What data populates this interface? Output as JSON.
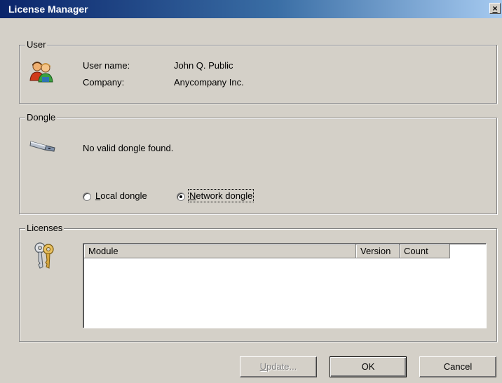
{
  "window": {
    "title": "License Manager",
    "close_glyph": "×"
  },
  "user": {
    "legend": "User",
    "icon": "users-icon",
    "name_label": "User name:",
    "name_value": "John Q. Public",
    "company_label": "Company:",
    "company_value": "Anycompany Inc."
  },
  "dongle": {
    "legend": "Dongle",
    "icon": "usb-dongle-icon",
    "status": "No valid dongle found.",
    "options": [
      {
        "accel": "L",
        "rest": "ocal dongle",
        "selected": false
      },
      {
        "accel": "N",
        "rest": "etwork dongle",
        "selected": true
      }
    ]
  },
  "licenses": {
    "legend": "Licenses",
    "icon": "keys-icon",
    "columns": [
      "Module",
      "Version",
      "Count"
    ],
    "rows": []
  },
  "buttons": {
    "update": {
      "accel": "U",
      "rest": "pdate...",
      "enabled": false
    },
    "ok": "OK",
    "cancel": "Cancel"
  },
  "colors": {
    "face": "#d4d0c8",
    "title_start": "#0a246a",
    "title_end": "#a6caf0"
  }
}
